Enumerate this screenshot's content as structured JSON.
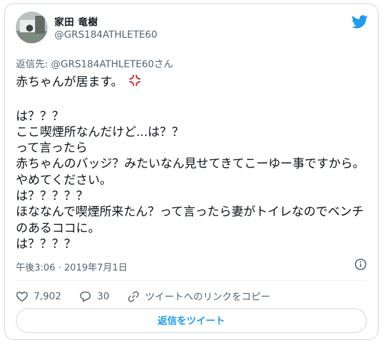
{
  "author": {
    "name": "家田 竜樹",
    "handle": "@GRS184ATHLETE60"
  },
  "tweet": {
    "reply_to": "返信先: @GRS184ATHLETE60さん",
    "first_line": "赤ちゃんが居ます。",
    "body": "は？？？\nここ喫煙所なんだけど...は？？\nって言ったら\n赤ちゃんのバッジ？みたいなん見せてきてこーゆー事ですから。やめてください。\nは？？？？？\nほななんで喫煙所来たん？って言ったら妻がトイレなのでベンチのあるココに。\nは？？？？",
    "emoji": "anger-symbol-icon",
    "timestamp": "午後3:06 · 2019年7月1日"
  },
  "actions": {
    "likes": "7,902",
    "replies": "30",
    "copy_link": "ツイートへのリンクをコピー"
  },
  "reply_button": "返信をツイート",
  "colors": {
    "accent": "#1d9bf0",
    "emoji": "#d62b3c",
    "secondary_text": "#536471",
    "border": "#cfd9de"
  }
}
